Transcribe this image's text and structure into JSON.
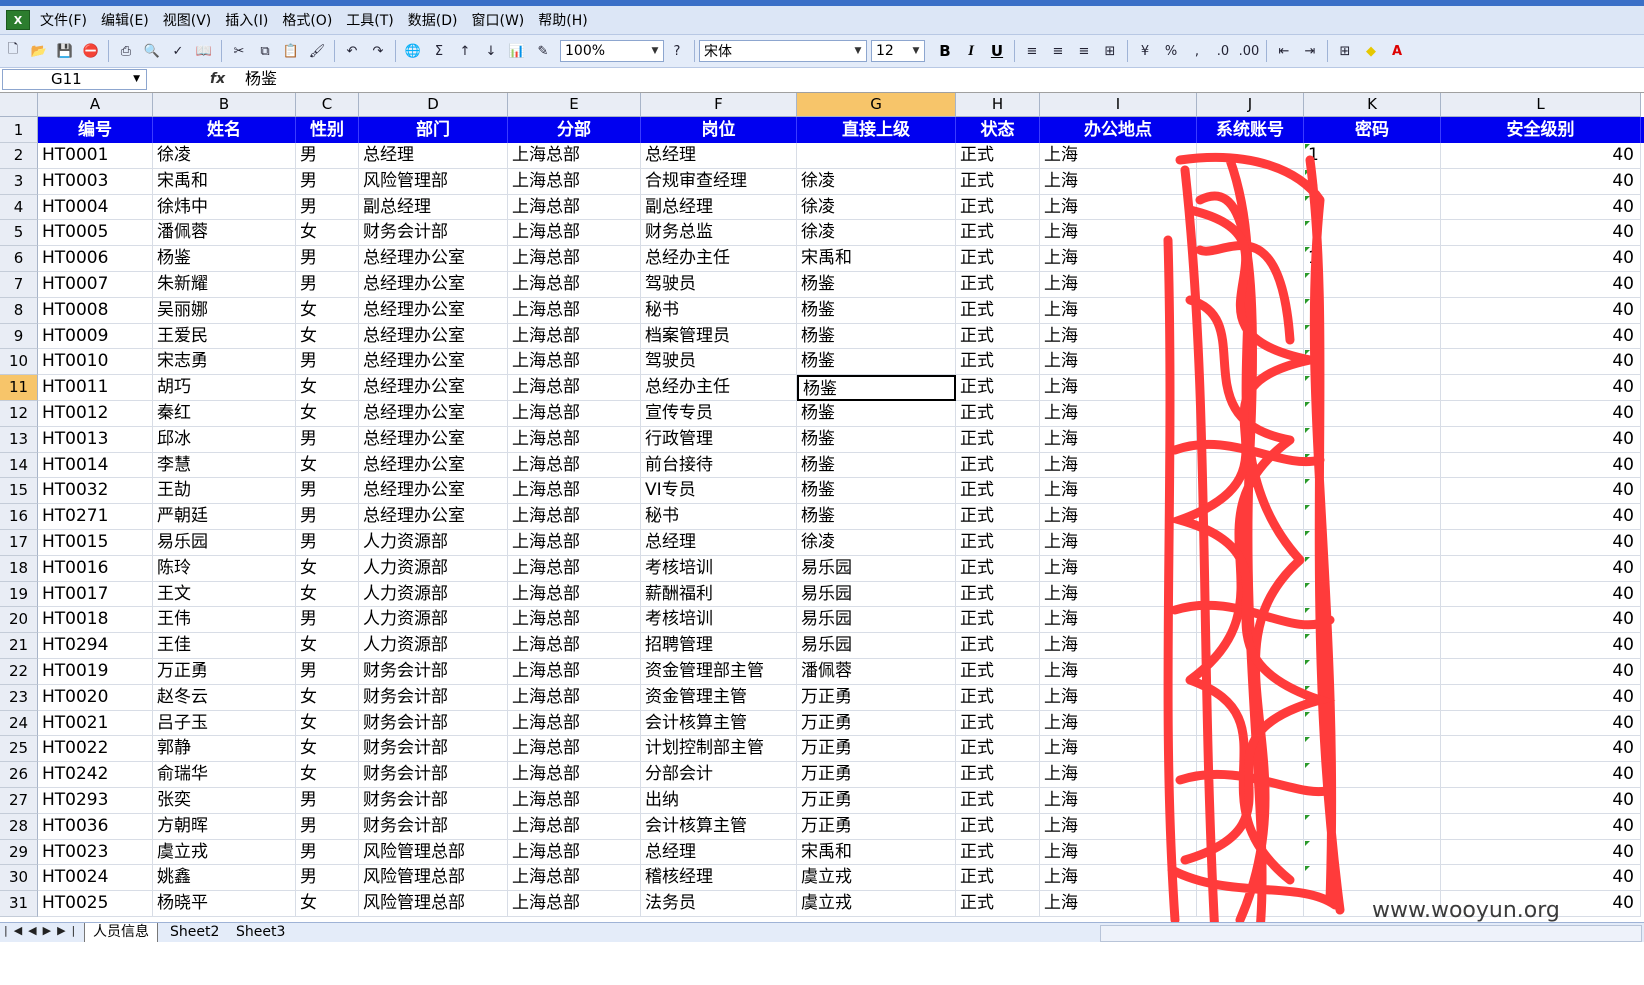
{
  "menu": [
    "文件(F)",
    "编辑(E)",
    "视图(V)",
    "插入(I)",
    "格式(O)",
    "工具(T)",
    "数据(D)",
    "窗口(W)",
    "帮助(H)"
  ],
  "toolbar": {
    "zoom": "100%",
    "font_name": "宋体",
    "font_size": "12",
    "bold": "B",
    "italic": "I",
    "underline": "U",
    "percent": "%",
    "comma": ",",
    "sum": "Σ"
  },
  "formula_bar": {
    "name_box": "G11",
    "fx": "fx",
    "formula": "杨鉴"
  },
  "columns": [
    "A",
    "B",
    "C",
    "D",
    "E",
    "F",
    "G",
    "H",
    "I",
    "J",
    "K",
    "L"
  ],
  "header": [
    "编号",
    "姓名",
    "性别",
    "部门",
    "分部",
    "岗位",
    "直接上级",
    "状态",
    "办公地点",
    "系统账号",
    "密码",
    "安全级别"
  ],
  "rows": [
    [
      "2",
      "HT0001",
      "徐凌",
      "男",
      "总经理",
      "上海总部",
      "总经理",
      "",
      "正式",
      "上海",
      "",
      "1",
      "40"
    ],
    [
      "3",
      "HT0003",
      "宋禹和",
      "男",
      "风险管理部",
      "上海总部",
      "合规审查经理",
      "徐凌",
      "正式",
      "上海",
      "",
      "1",
      "40"
    ],
    [
      "4",
      "HT0004",
      "徐炜中",
      "男",
      "副总经理",
      "上海总部",
      "副总经理",
      "徐凌",
      "正式",
      "上海",
      "",
      "",
      "40"
    ],
    [
      "5",
      "HT0005",
      "潘佩蓉",
      "女",
      "财务会计部",
      "上海总部",
      "财务总监",
      "徐凌",
      "正式",
      "上海",
      "",
      "",
      "40"
    ],
    [
      "6",
      "HT0006",
      "杨鉴",
      "男",
      "总经理办公室",
      "上海总部",
      "总经办主任",
      "宋禹和",
      "正式",
      "上海",
      "",
      "1",
      "40"
    ],
    [
      "7",
      "HT0007",
      "朱新耀",
      "男",
      "总经理办公室",
      "上海总部",
      "驾驶员",
      "杨鉴",
      "正式",
      "上海",
      "",
      "",
      "40"
    ],
    [
      "8",
      "HT0008",
      "吴丽娜",
      "女",
      "总经理办公室",
      "上海总部",
      "秘书",
      "杨鉴",
      "正式",
      "上海",
      "",
      "",
      "40"
    ],
    [
      "9",
      "HT0009",
      "王爱民",
      "女",
      "总经理办公室",
      "上海总部",
      "档案管理员",
      "杨鉴",
      "正式",
      "上海",
      "",
      "",
      "40"
    ],
    [
      "10",
      "HT0010",
      "宋志勇",
      "男",
      "总经理办公室",
      "上海总部",
      "驾驶员",
      "杨鉴",
      "正式",
      "上海",
      "",
      "",
      "40"
    ],
    [
      "11",
      "HT0011",
      "胡巧",
      "女",
      "总经理办公室",
      "上海总部",
      "总经办主任",
      "杨鉴",
      "正式",
      "上海",
      "",
      "",
      "40"
    ],
    [
      "12",
      "HT0012",
      "秦红",
      "女",
      "总经理办公室",
      "上海总部",
      "宣传专员",
      "杨鉴",
      "正式",
      "上海",
      "",
      "",
      "40"
    ],
    [
      "13",
      "HT0013",
      "邱冰",
      "男",
      "总经理办公室",
      "上海总部",
      "行政管理",
      "杨鉴",
      "正式",
      "上海",
      "",
      "",
      "40"
    ],
    [
      "14",
      "HT0014",
      "李慧",
      "女",
      "总经理办公室",
      "上海总部",
      "前台接待",
      "杨鉴",
      "正式",
      "上海",
      "",
      "",
      "40"
    ],
    [
      "15",
      "HT0032",
      "王劼",
      "男",
      "总经理办公室",
      "上海总部",
      "VI专员",
      "杨鉴",
      "正式",
      "上海",
      "",
      "",
      "40"
    ],
    [
      "16",
      "HT0271",
      "严朝廷",
      "男",
      "总经理办公室",
      "上海总部",
      "秘书",
      "杨鉴",
      "正式",
      "上海",
      "",
      "",
      "40"
    ],
    [
      "17",
      "HT0015",
      "易乐园",
      "男",
      "人力资源部",
      "上海总部",
      "总经理",
      "徐凌",
      "正式",
      "上海",
      "",
      "",
      "40"
    ],
    [
      "18",
      "HT0016",
      "陈玲",
      "女",
      "人力资源部",
      "上海总部",
      "考核培训",
      "易乐园",
      "正式",
      "上海",
      "",
      "",
      "40"
    ],
    [
      "19",
      "HT0017",
      "王文",
      "女",
      "人力资源部",
      "上海总部",
      "薪酬福利",
      "易乐园",
      "正式",
      "上海",
      "",
      "",
      "40"
    ],
    [
      "20",
      "HT0018",
      "王伟",
      "男",
      "人力资源部",
      "上海总部",
      "考核培训",
      "易乐园",
      "正式",
      "上海",
      "",
      "",
      "40"
    ],
    [
      "21",
      "HT0294",
      "王佳",
      "女",
      "人力资源部",
      "上海总部",
      "招聘管理",
      "易乐园",
      "正式",
      "上海",
      "",
      "",
      "40"
    ],
    [
      "22",
      "HT0019",
      "万正勇",
      "男",
      "财务会计部",
      "上海总部",
      "资金管理部主管",
      "潘佩蓉",
      "正式",
      "上海",
      "",
      "",
      "40"
    ],
    [
      "23",
      "HT0020",
      "赵冬云",
      "女",
      "财务会计部",
      "上海总部",
      "资金管理主管",
      "万正勇",
      "正式",
      "上海",
      "",
      "",
      "40"
    ],
    [
      "24",
      "HT0021",
      "吕子玉",
      "女",
      "财务会计部",
      "上海总部",
      "会计核算主管",
      "万正勇",
      "正式",
      "上海",
      "",
      "",
      "40"
    ],
    [
      "25",
      "HT0022",
      "郭静",
      "女",
      "财务会计部",
      "上海总部",
      "计划控制部主管",
      "万正勇",
      "正式",
      "上海",
      "",
      "",
      "40"
    ],
    [
      "26",
      "HT0242",
      "俞瑞华",
      "女",
      "财务会计部",
      "上海总部",
      "分部会计",
      "万正勇",
      "正式",
      "上海",
      "",
      "",
      "40"
    ],
    [
      "27",
      "HT0293",
      "张奕",
      "男",
      "财务会计部",
      "上海总部",
      "出纳",
      "万正勇",
      "正式",
      "上海",
      "",
      "",
      "40"
    ],
    [
      "28",
      "HT0036",
      "方朝晖",
      "男",
      "财务会计部",
      "上海总部",
      "会计核算主管",
      "万正勇",
      "正式",
      "上海",
      "",
      "",
      "40"
    ],
    [
      "29",
      "HT0023",
      "虞立戎",
      "男",
      "风险管理总部",
      "上海总部",
      "总经理",
      "宋禹和",
      "正式",
      "上海",
      "",
      "",
      "40"
    ],
    [
      "30",
      "HT0024",
      "姚鑫",
      "男",
      "风险管理总部",
      "上海总部",
      "稽核经理",
      "虞立戎",
      "正式",
      "上海",
      "",
      "",
      "40"
    ],
    [
      "31",
      "HT0025",
      "杨晓平",
      "女",
      "风险管理总部",
      "上海总部",
      "法务员",
      "虞立戎",
      "正式",
      "上海",
      "",
      "",
      "40"
    ]
  ],
  "sheets": [
    "人员信息",
    "Sheet2",
    "Sheet3"
  ],
  "watermark": "www.wooyun.org",
  "colors": {
    "header_bg": "#0000f0",
    "scribble": "#ff3b3b",
    "active_header": "#f7c56a"
  }
}
